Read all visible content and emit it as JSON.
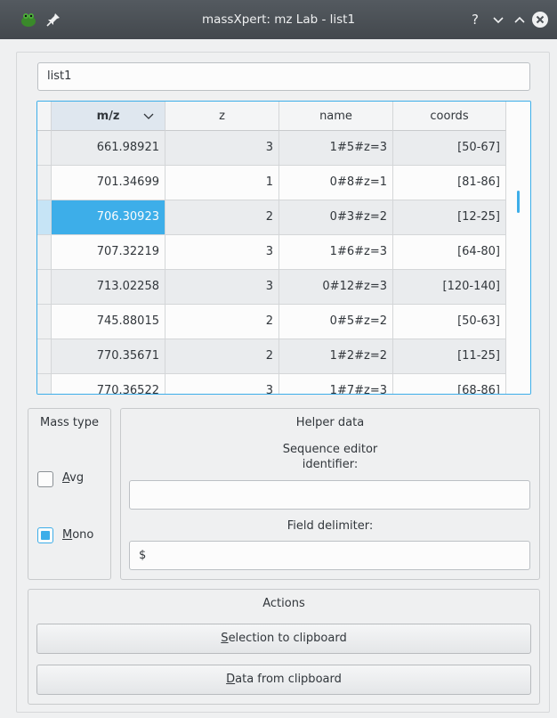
{
  "window": {
    "title": "massXpert: mz Lab - list1",
    "help_label": "?",
    "minimize_label": "⌄",
    "maximize_label": "⌃",
    "close_label": "✕"
  },
  "list_name": "list1",
  "table": {
    "columns": [
      "m/z",
      "z",
      "name",
      "coords"
    ],
    "sort_indicator": "⌄",
    "rows": [
      {
        "mz": "661.98921",
        "z": "3",
        "name": "1#5#z=3",
        "coords": "[50-67]"
      },
      {
        "mz": "701.34699",
        "z": "1",
        "name": "0#8#z=1",
        "coords": "[81-86]"
      },
      {
        "mz": "706.30923",
        "z": "2",
        "name": "0#3#z=2",
        "coords": "[12-25]"
      },
      {
        "mz": "707.32219",
        "z": "3",
        "name": "1#6#z=3",
        "coords": "[64-80]"
      },
      {
        "mz": "713.02258",
        "z": "3",
        "name": "0#12#z=3",
        "coords": "[120-140]"
      },
      {
        "mz": "745.88015",
        "z": "2",
        "name": "0#5#z=2",
        "coords": "[50-63]"
      },
      {
        "mz": "770.35671",
        "z": "2",
        "name": "1#2#z=2",
        "coords": "[11-25]"
      },
      {
        "mz": "770.36522",
        "z": "3",
        "name": "1#7#z=3",
        "coords": "[68-86]"
      }
    ]
  },
  "mass_type": {
    "title": "Mass type",
    "avg_first": "A",
    "avg_rest": "vg",
    "avg_checked": false,
    "mono_first": "M",
    "mono_rest": "ono",
    "mono_checked": true
  },
  "helper": {
    "title": "Helper data",
    "seq_label_line1": "Sequence editor",
    "seq_label_line2": "identifier:",
    "seq_value": "",
    "delim_label": "Field delimiter:",
    "delim_value": "$"
  },
  "actions": {
    "title": "Actions",
    "sel_first": "S",
    "sel_rest": "election to clipboard",
    "data_first": "D",
    "data_rest": "ata from clipboard"
  },
  "colors": {
    "accent": "#3daee9",
    "titlebar": "#4d5257"
  }
}
